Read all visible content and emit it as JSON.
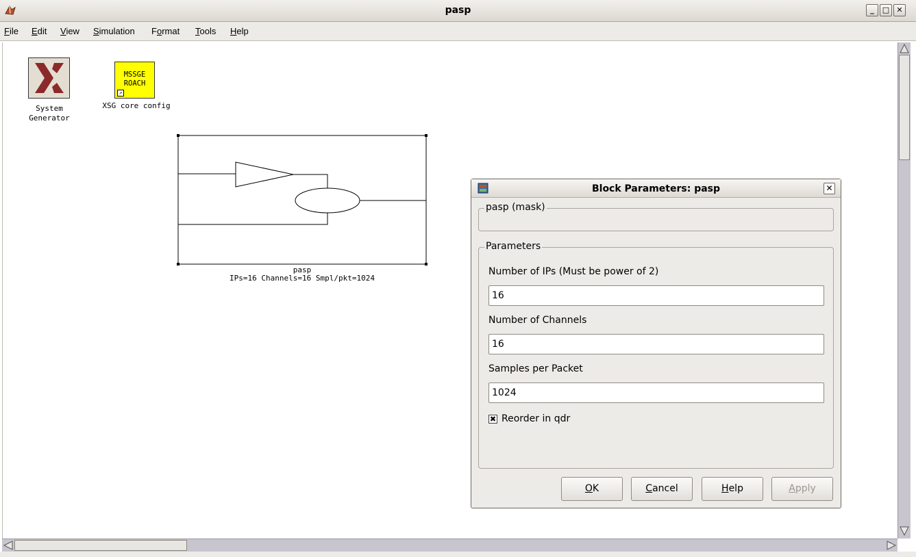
{
  "window": {
    "title": "pasp"
  },
  "menu": [
    {
      "mnemonic": "F",
      "rest": "ile"
    },
    {
      "mnemonic": "E",
      "rest": "dit"
    },
    {
      "mnemonic": "V",
      "rest": "iew"
    },
    {
      "mnemonic": "S",
      "rest": "imulation"
    },
    {
      "pre": "F",
      "mnemonic": "o",
      "rest": "rmat"
    },
    {
      "mnemonic": "T",
      "rest": "ools"
    },
    {
      "mnemonic": "H",
      "rest": "elp"
    }
  ],
  "blocks": {
    "system_generator": {
      "label_line1": "System",
      "label_line2": "Generator",
      "icon": "xilinx-logo-icon"
    },
    "xsg_core_config": {
      "text_line1": "MSSGE",
      "text_line2": "ROACH",
      "label": "XSG core config",
      "color": "#ffff00"
    },
    "pasp": {
      "name": "pasp",
      "summary": "IPs=16 Channels=16 Smpl/pkt=1024"
    }
  },
  "dialog": {
    "title": "Block Parameters: pasp",
    "mask_group_label": "pasp (mask)",
    "params_group_label": "Parameters",
    "fields": [
      {
        "label": "Number of IPs (Must be power of 2)",
        "value": "16"
      },
      {
        "label": "Number of Channels",
        "value": "16"
      },
      {
        "label": "Samples per Packet",
        "value": "1024"
      }
    ],
    "checkbox": {
      "label": "Reorder in qdr",
      "checked": true
    },
    "buttons": {
      "ok": {
        "mnemonic": "O",
        "rest": "K"
      },
      "cancel": {
        "mnemonic": "C",
        "rest": "ancel"
      },
      "help": {
        "mnemonic": "H",
        "rest": "elp"
      },
      "apply": {
        "mnemonic": "A",
        "rest": "pply",
        "enabled": false
      }
    }
  },
  "colors": {
    "chrome": "#edebe7",
    "scrollbar": "#c9c5cf",
    "xilinx_red": "#8b2a2a"
  }
}
